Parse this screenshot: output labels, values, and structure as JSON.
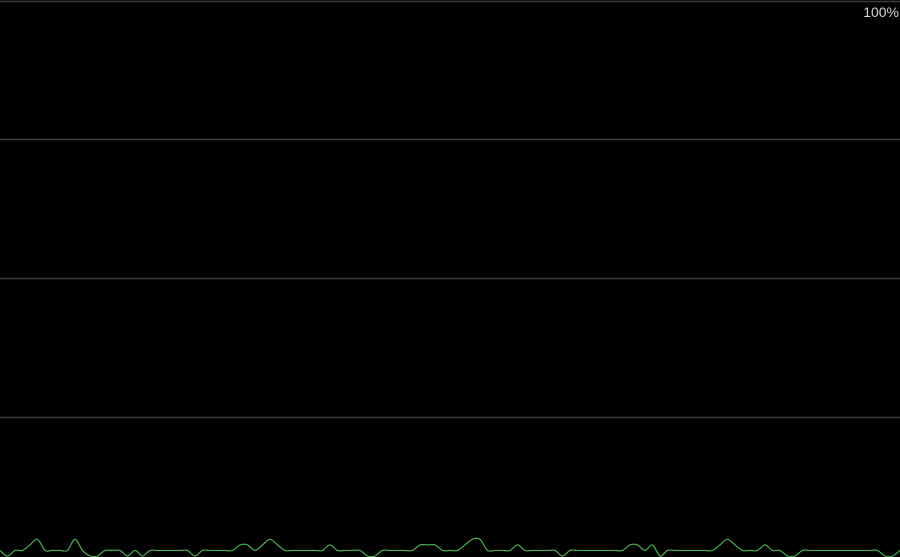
{
  "chart_data": {
    "type": "line",
    "ylim": [
      0,
      100
    ],
    "y_max_label": "100%",
    "grid": true,
    "grid_color": "#3c3c3c",
    "line_color": "#4caf50",
    "background": "#000000",
    "series": [
      {
        "values": [
          1,
          0,
          1,
          1,
          2,
          3,
          1,
          1,
          1,
          1,
          3,
          1,
          0,
          0,
          1,
          1,
          1,
          0,
          1,
          0,
          1,
          1,
          1,
          1,
          1,
          1,
          0,
          1,
          1,
          1,
          1,
          1,
          2,
          2,
          1,
          2,
          3,
          2,
          1,
          1,
          1,
          1,
          1,
          1,
          2,
          1,
          1,
          1,
          1,
          0,
          0,
          1,
          1,
          1,
          1,
          1,
          2,
          2,
          2,
          1,
          1,
          1,
          2,
          3,
          3,
          1,
          1,
          1,
          1,
          2,
          1,
          1,
          1,
          1,
          1,
          0,
          1,
          1,
          1,
          1,
          1,
          1,
          1,
          1,
          2,
          2,
          1,
          2,
          0,
          1,
          1,
          1,
          1,
          1,
          1,
          1,
          2,
          3,
          2,
          1,
          1,
          1,
          2,
          1,
          1,
          0,
          0,
          1,
          1,
          1,
          1,
          1,
          1,
          1,
          1,
          1,
          1,
          1,
          0,
          0,
          1
        ]
      }
    ]
  }
}
